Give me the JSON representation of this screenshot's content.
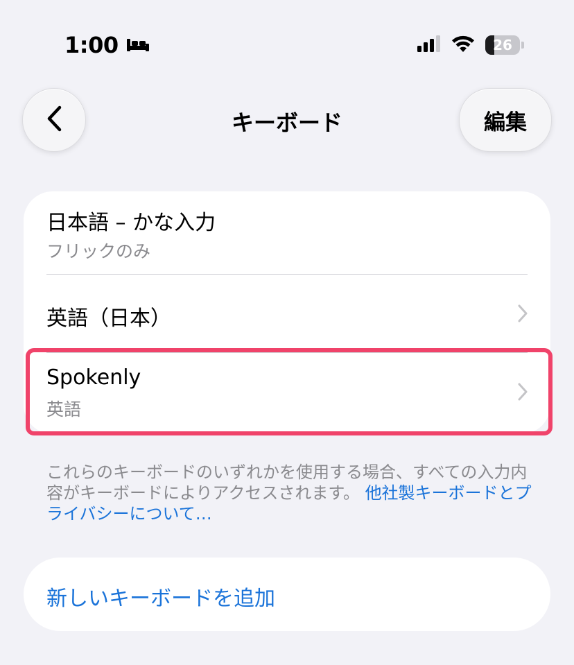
{
  "status_bar": {
    "time": "1:00",
    "battery_level": "26",
    "battery_fraction": 0.26
  },
  "nav": {
    "title": "キーボード",
    "edit_label": "編集"
  },
  "keyboards": {
    "items": [
      {
        "title": "日本語 – かな入力",
        "subtitle": "フリックのみ"
      },
      {
        "title": "英語（日本）",
        "subtitle": ""
      },
      {
        "title": "Spokenly",
        "subtitle": "英語"
      }
    ]
  },
  "footnote": {
    "text": "これらのキーボードのいずれかを使用する場合、すべての入力内容がキーボードによりアクセスされます。",
    "link": "他社製キーボードとプライバシーについて…"
  },
  "add_keyboard": {
    "label": "新しいキーボードを追加"
  },
  "colors": {
    "background": "#f2f2f7",
    "accent": "#1a73d9",
    "highlight": "#f0436a",
    "secondary_text": "#8a8a8e"
  }
}
